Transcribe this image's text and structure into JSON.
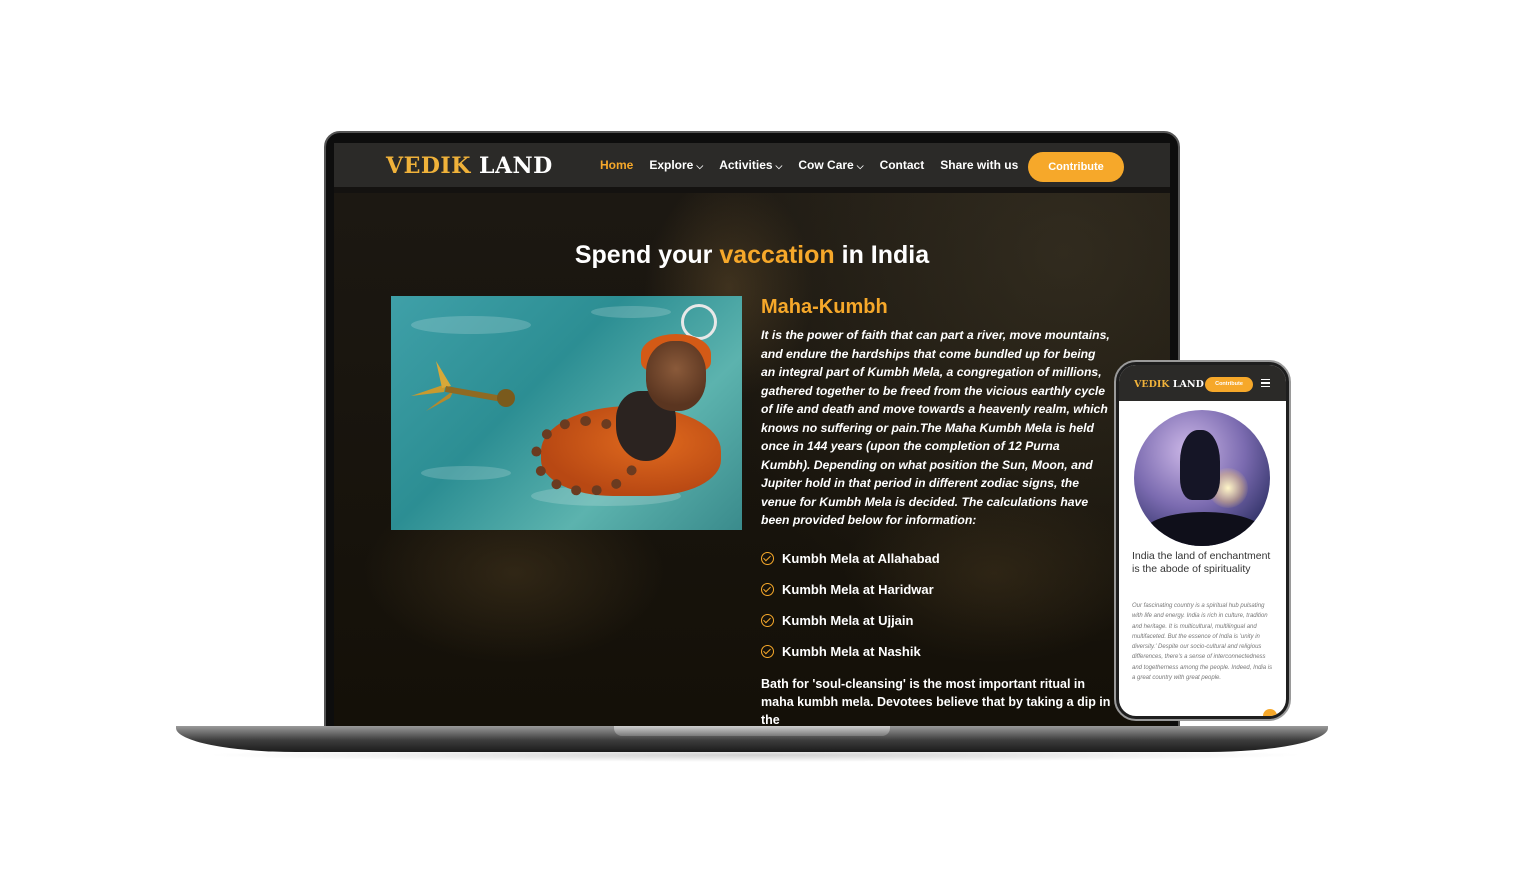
{
  "site": {
    "logo_part1": "VEDIK",
    "logo_part2": "LAND",
    "nav": [
      {
        "label": "Home",
        "dropdown": false,
        "active": true
      },
      {
        "label": "Explore",
        "dropdown": true
      },
      {
        "label": "Activities",
        "dropdown": true
      },
      {
        "label": "Cow Care",
        "dropdown": true
      },
      {
        "label": "Contact",
        "dropdown": false
      },
      {
        "label": "Share with us",
        "dropdown": false
      }
    ],
    "dropdown_glyph": "⌵",
    "contribute_label": "Contribute"
  },
  "hero": {
    "title_prefix": "Spend your ",
    "title_accent": "vaccation",
    "title_suffix": " in India",
    "section_title": "Maha-Kumbh",
    "paragraph": "It is the power of faith that can part a river, move mountains, and endure the hardships that come bundled up for being an integral part of Kumbh Mela, a congregation of millions, gathered together to be freed from the vicious earthly cycle of life and death and move towards a heavenly realm, which knows no suffering or pain.The Maha Kumbh Mela is held once in 144 years (upon the completion of 12 Purna Kumbh). Depending on what position the Sun, Moon, and Jupiter hold in that period in different zodiac signs, the venue for Kumbh Mela is decided. The calculations have been provided below for information:",
    "checklist": [
      "Kumbh Mela at Allahabad",
      "Kumbh Mela at Haridwar",
      "Kumbh Mela at Ujjain",
      "Kumbh Mela at Nashik"
    ],
    "bath_text": "Bath for 'soul-cleansing' is the most important ritual in maha kumbh mela. Devotees believe that by taking a dip in the"
  },
  "mobile": {
    "logo_part1": "VEDIK",
    "logo_part2": "LAND",
    "contribute_label": "Contribute",
    "heading": "India the land of enchantment is the abode of spirituality",
    "paragraph": "Our fascinating country is a spiritual hub pulsating with life and energy. India is rich in culture, tradition and heritage. It is multicultural, multilingual and multifaceted. But the essence of India is 'unity in diversity.' Despite our socio-cultural and religious differences, there's a sense of interconnectedness and togetherness among the people. Indeed, India is a great country with great people."
  },
  "colors": {
    "accent": "#f6a82a",
    "logo_gold": "#f0b23a",
    "header_bg": "#2b2a28"
  }
}
